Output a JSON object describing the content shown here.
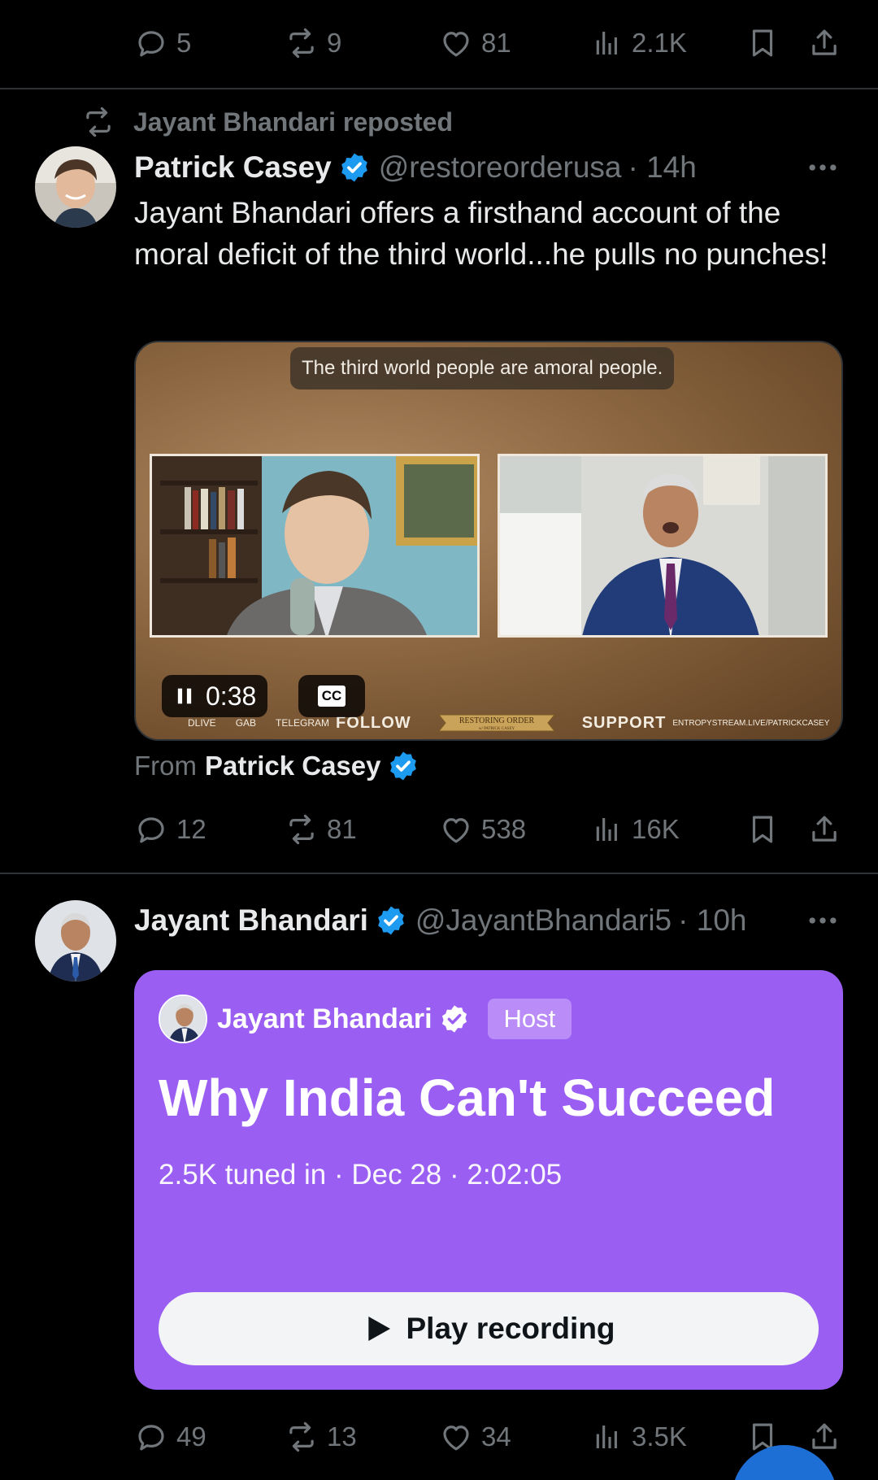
{
  "top_actions": {
    "replies": "5",
    "reposts": "9",
    "likes": "81",
    "views": "2.1K"
  },
  "tweet1": {
    "repost_text": "Jayant Bhandari reposted",
    "author_name": "Patrick Casey",
    "handle": "@restoreorderusa",
    "time": "· 14h",
    "text": "Jayant Bhandari offers a firsthand account of the moral deficit of the third world...he pulls no punches!",
    "video": {
      "caption": "The third world people are amoral people.",
      "time": "0:38",
      "cc_label": "CC",
      "footer_small_1": "DLIVE",
      "footer_small_2": "GAB",
      "footer_small_3": "TELEGRAM",
      "footer_follow": "FOLLOW",
      "banner_text": "RESTORING ORDER",
      "banner_sub": "w/ PATRICK CASEY",
      "footer_support": "SUPPORT",
      "footer_url": "ENTROPYSTREAM.LIVE/PATRICKCASEY"
    },
    "from_label": "From",
    "from_name": "Patrick Casey",
    "actions": {
      "replies": "12",
      "reposts": "81",
      "likes": "538",
      "views": "16K"
    }
  },
  "tweet2": {
    "author_name": "Jayant Bhandari",
    "handle": "@JayantBhandari5",
    "time": "· 10h",
    "space": {
      "host_name": "Jayant Bhandari",
      "host_badge": "Host",
      "title": "Why India Can't Succeed",
      "meta": "2.5K tuned in · Dec 28 · 2:02:05",
      "play_label": "Play recording",
      "color": "#9a5ff2"
    },
    "actions": {
      "replies": "49",
      "reposts": "13",
      "likes": "34",
      "views": "3.5K"
    }
  },
  "colors": {
    "background": "#000000",
    "muted": "#71767b",
    "verified": "#1d9bf0"
  }
}
